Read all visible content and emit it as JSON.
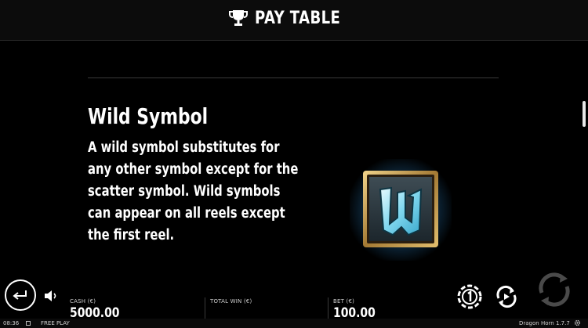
{
  "header": {
    "title": "PAY TABLE",
    "icon": "trophy-icon"
  },
  "section": {
    "title": "Wild Symbol",
    "description_lines": [
      "A wild symbol substitutes for",
      "any other symbol except for the",
      "scatter symbol. Wild symbols",
      "can appear on all reels except",
      "the first reel."
    ],
    "symbol_letter": "W",
    "symbol_icon": "wild-symbol-icon"
  },
  "bottom_bar": {
    "cash_label": "CASH (€)",
    "cash_value": "5000.00",
    "total_win_label": "TOTAL WIN (€)",
    "total_win_value": "",
    "bet_label": "BET (€)",
    "bet_value": "100.00"
  },
  "footer": {
    "time": "08:36",
    "mode": "FREE PLAY",
    "game_name": "Dragon Horn",
    "version": "1.7.7"
  },
  "colors": {
    "background": "#000000",
    "text": "#ffffff",
    "symbol_accent": "#7fd6ee",
    "symbol_frame": "#c9a25a"
  }
}
